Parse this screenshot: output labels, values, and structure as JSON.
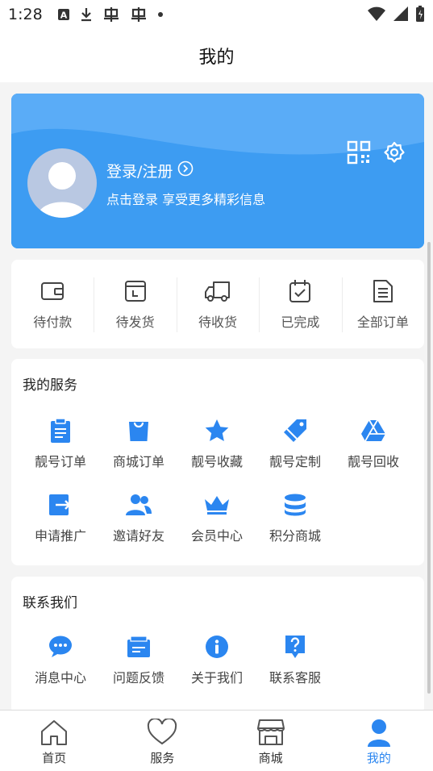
{
  "status_bar": {
    "time": "1:28"
  },
  "header": {
    "title": "我的"
  },
  "profile": {
    "login_label": "登录/注册",
    "subtitle": "点击登录 享受更多精彩信息"
  },
  "orders": [
    {
      "label": "待付款",
      "icon": "wallet-icon"
    },
    {
      "label": "待发货",
      "icon": "package-icon"
    },
    {
      "label": "待收货",
      "icon": "truck-icon"
    },
    {
      "label": "已完成",
      "icon": "calendar-check-icon"
    },
    {
      "label": "全部订单",
      "icon": "document-icon"
    }
  ],
  "services": {
    "title": "我的服务",
    "items": [
      {
        "label": "靓号订单",
        "icon": "clipboard-icon"
      },
      {
        "label": "商城订单",
        "icon": "shopping-bag-icon"
      },
      {
        "label": "靓号收藏",
        "icon": "star-icon"
      },
      {
        "label": "靓号定制",
        "icon": "tag-icon"
      },
      {
        "label": "靓号回收",
        "icon": "triangle-drive-icon"
      },
      {
        "label": "申请推广",
        "icon": "share-box-icon"
      },
      {
        "label": "邀请好友",
        "icon": "users-icon"
      },
      {
        "label": "会员中心",
        "icon": "crown-icon"
      },
      {
        "label": "积分商城",
        "icon": "coins-stack-icon"
      }
    ]
  },
  "contact": {
    "title": "联系我们",
    "items": [
      {
        "label": "消息中心",
        "icon": "chat-bubble-icon"
      },
      {
        "label": "问题反馈",
        "icon": "feedback-icon"
      },
      {
        "label": "关于我们",
        "icon": "info-icon"
      },
      {
        "label": "联系客服",
        "icon": "help-bubble-icon"
      }
    ]
  },
  "bottom_nav": [
    {
      "label": "首页",
      "icon": "home-icon"
    },
    {
      "label": "服务",
      "icon": "heart-icon"
    },
    {
      "label": "商城",
      "icon": "store-icon"
    },
    {
      "label": "我的",
      "icon": "person-icon",
      "active": true
    }
  ],
  "colors": {
    "accent": "#2b86f0",
    "card_blue": "#4aa3f5"
  }
}
